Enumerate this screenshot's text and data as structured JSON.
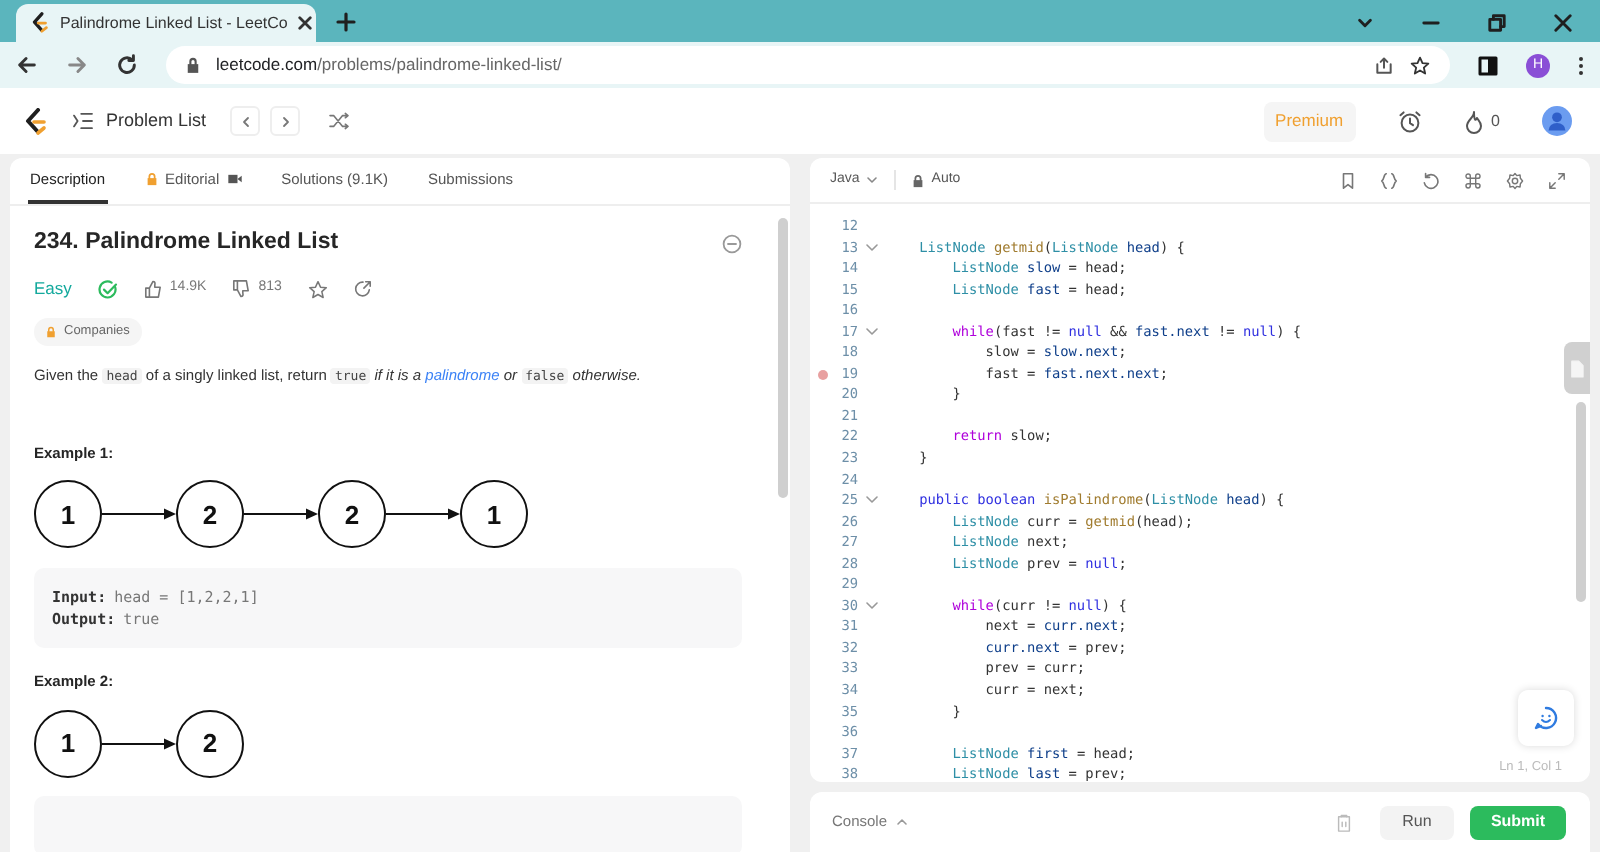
{
  "browser": {
    "tab_title": "Palindrome Linked List - LeetCo",
    "url_host": "leetcode.com",
    "url_path": "/problems/palindrome-linked-list/",
    "profile_initial": "H"
  },
  "header": {
    "problem_list": "Problem List",
    "premium": "Premium",
    "streak": "0"
  },
  "tabs": [
    {
      "label": "Description",
      "selected": true,
      "locked": false,
      "video": false
    },
    {
      "label": "Editorial",
      "selected": false,
      "locked": true,
      "video": true
    },
    {
      "label": "Solutions (9.1K)",
      "selected": false,
      "locked": false,
      "video": false
    },
    {
      "label": "Submissions",
      "selected": false,
      "locked": false,
      "video": false
    }
  ],
  "problem": {
    "title": "234. Palindrome Linked List",
    "difficulty": "Easy",
    "solved": true,
    "likes": "14.9K",
    "dislikes": "813",
    "companies": "Companies",
    "description": [
      {
        "kind": "text",
        "text": "Given the "
      },
      {
        "kind": "code",
        "text": "head"
      },
      {
        "kind": "text",
        "text": " of a singly linked list, return "
      },
      {
        "kind": "code",
        "text": "true"
      },
      {
        "kind": "italic",
        "text": " if it is a "
      },
      {
        "kind": "link",
        "text": "palindrome"
      },
      {
        "kind": "italic",
        "text": " or "
      },
      {
        "kind": "code",
        "text": "false"
      },
      {
        "kind": "italic",
        "text": " otherwise."
      }
    ],
    "examples": [
      {
        "title": "Example 1:",
        "nodes": [
          "1",
          "2",
          "2",
          "1"
        ],
        "input_label": "Input:",
        "input": "head = [1,2,2,1]",
        "output_label": "Output:",
        "output": "true"
      },
      {
        "title": "Example 2:",
        "nodes": [
          "1",
          "2"
        ]
      }
    ]
  },
  "editor": {
    "language": "Java",
    "mode": "Auto",
    "cursor": "Ln 1, Col 1",
    "lines": [
      {
        "number": "12",
        "fold": false,
        "breakpoint": false
      },
      {
        "number": "13",
        "fold": true,
        "breakpoint": false,
        "tokens": [
          {
            "kind": "type",
            "text": "    ListNode"
          },
          {
            "kind": "fn",
            "text": " getmid"
          },
          {
            "kind": "plain",
            "text": "("
          },
          {
            "kind": "type",
            "text": "ListNode"
          },
          {
            "kind": "var",
            "text": " head"
          },
          {
            "kind": "plain",
            "text": ") {"
          }
        ]
      },
      {
        "number": "14",
        "fold": false,
        "breakpoint": false,
        "tokens": [
          {
            "kind": "type",
            "text": "        ListNode"
          },
          {
            "kind": "var",
            "text": " slow"
          },
          {
            "kind": "plain",
            "text": " = head;"
          }
        ]
      },
      {
        "number": "15",
        "fold": false,
        "breakpoint": false,
        "tokens": [
          {
            "kind": "type",
            "text": "        ListNode"
          },
          {
            "kind": "var",
            "text": " fast"
          },
          {
            "kind": "plain",
            "text": " = head;"
          }
        ]
      },
      {
        "number": "16",
        "fold": false,
        "breakpoint": false
      },
      {
        "number": "17",
        "fold": true,
        "breakpoint": false,
        "tokens": [
          {
            "kind": "keyword",
            "text": "        while"
          },
          {
            "kind": "plain",
            "text": "(fast != "
          },
          {
            "kind": "const",
            "text": "null"
          },
          {
            "kind": "plain",
            "text": " && "
          },
          {
            "kind": "var",
            "text": "fast.next"
          },
          {
            "kind": "plain",
            "text": " != "
          },
          {
            "kind": "const",
            "text": "null"
          },
          {
            "kind": "plain",
            "text": ") {"
          }
        ]
      },
      {
        "number": "18",
        "fold": false,
        "breakpoint": false,
        "tokens": [
          {
            "kind": "plain",
            "text": "            slow = "
          },
          {
            "kind": "var",
            "text": "slow.next"
          },
          {
            "kind": "plain",
            "text": ";"
          }
        ]
      },
      {
        "number": "19",
        "fold": false,
        "breakpoint": true,
        "tokens": [
          {
            "kind": "plain",
            "text": "            fast = "
          },
          {
            "kind": "var",
            "text": "fast.next.next"
          },
          {
            "kind": "plain",
            "text": ";"
          }
        ]
      },
      {
        "number": "20",
        "fold": false,
        "breakpoint": false,
        "tokens": [
          {
            "kind": "plain",
            "text": "        }"
          }
        ]
      },
      {
        "number": "21",
        "fold": false,
        "breakpoint": false
      },
      {
        "number": "22",
        "fold": false,
        "breakpoint": false,
        "tokens": [
          {
            "kind": "keyword",
            "text": "        return"
          },
          {
            "kind": "plain",
            "text": " slow;"
          }
        ]
      },
      {
        "number": "23",
        "fold": false,
        "breakpoint": false,
        "tokens": [
          {
            "kind": "plain",
            "text": "    }"
          }
        ]
      },
      {
        "number": "24",
        "fold": false,
        "breakpoint": false
      },
      {
        "number": "25",
        "fold": true,
        "breakpoint": false,
        "tokens": [
          {
            "kind": "const",
            "text": "    public boolean"
          },
          {
            "kind": "fn",
            "text": " isPalindrome"
          },
          {
            "kind": "plain",
            "text": "("
          },
          {
            "kind": "type",
            "text": "ListNode"
          },
          {
            "kind": "var",
            "text": " head"
          },
          {
            "kind": "plain",
            "text": ") {"
          }
        ]
      },
      {
        "number": "26",
        "fold": false,
        "breakpoint": false,
        "tokens": [
          {
            "kind": "type",
            "text": "        ListNode"
          },
          {
            "kind": "plain",
            "text": " curr = "
          },
          {
            "kind": "fn",
            "text": "getmid"
          },
          {
            "kind": "plain",
            "text": "(head);"
          }
        ]
      },
      {
        "number": "27",
        "fold": false,
        "breakpoint": false,
        "tokens": [
          {
            "kind": "type",
            "text": "        ListNode"
          },
          {
            "kind": "plain",
            "text": " next;"
          }
        ]
      },
      {
        "number": "28",
        "fold": false,
        "breakpoint": false,
        "tokens": [
          {
            "kind": "type",
            "text": "        ListNode"
          },
          {
            "kind": "plain",
            "text": " prev = "
          },
          {
            "kind": "const",
            "text": "null"
          },
          {
            "kind": "plain",
            "text": ";"
          }
        ]
      },
      {
        "number": "29",
        "fold": false,
        "breakpoint": false
      },
      {
        "number": "30",
        "fold": true,
        "breakpoint": false,
        "tokens": [
          {
            "kind": "keyword",
            "text": "        while"
          },
          {
            "kind": "plain",
            "text": "(curr != "
          },
          {
            "kind": "const",
            "text": "null"
          },
          {
            "kind": "plain",
            "text": ") {"
          }
        ]
      },
      {
        "number": "31",
        "fold": false,
        "breakpoint": false,
        "tokens": [
          {
            "kind": "plain",
            "text": "            next = "
          },
          {
            "kind": "var",
            "text": "curr.next"
          },
          {
            "kind": "plain",
            "text": ";"
          }
        ]
      },
      {
        "number": "32",
        "fold": false,
        "breakpoint": false,
        "tokens": [
          {
            "kind": "var",
            "text": "            curr.next"
          },
          {
            "kind": "plain",
            "text": " = prev;"
          }
        ]
      },
      {
        "number": "33",
        "fold": false,
        "breakpoint": false,
        "tokens": [
          {
            "kind": "plain",
            "text": "            prev = curr;"
          }
        ]
      },
      {
        "number": "34",
        "fold": false,
        "breakpoint": false,
        "tokens": [
          {
            "kind": "plain",
            "text": "            curr = next;"
          }
        ]
      },
      {
        "number": "35",
        "fold": false,
        "breakpoint": false,
        "tokens": [
          {
            "kind": "plain",
            "text": "        }"
          }
        ]
      },
      {
        "number": "36",
        "fold": false,
        "breakpoint": false
      },
      {
        "number": "37",
        "fold": false,
        "breakpoint": false,
        "tokens": [
          {
            "kind": "type",
            "text": "        ListNode"
          },
          {
            "kind": "var",
            "text": " first"
          },
          {
            "kind": "plain",
            "text": " = head;"
          }
        ]
      },
      {
        "number": "38",
        "fold": false,
        "breakpoint": false,
        "tokens": [
          {
            "kind": "type",
            "text": "        ListNode"
          },
          {
            "kind": "var",
            "text": " last"
          },
          {
            "kind": "plain",
            "text": " = prev;"
          }
        ]
      }
    ]
  },
  "console": {
    "label": "Console",
    "run": "Run",
    "submit": "Submit"
  }
}
